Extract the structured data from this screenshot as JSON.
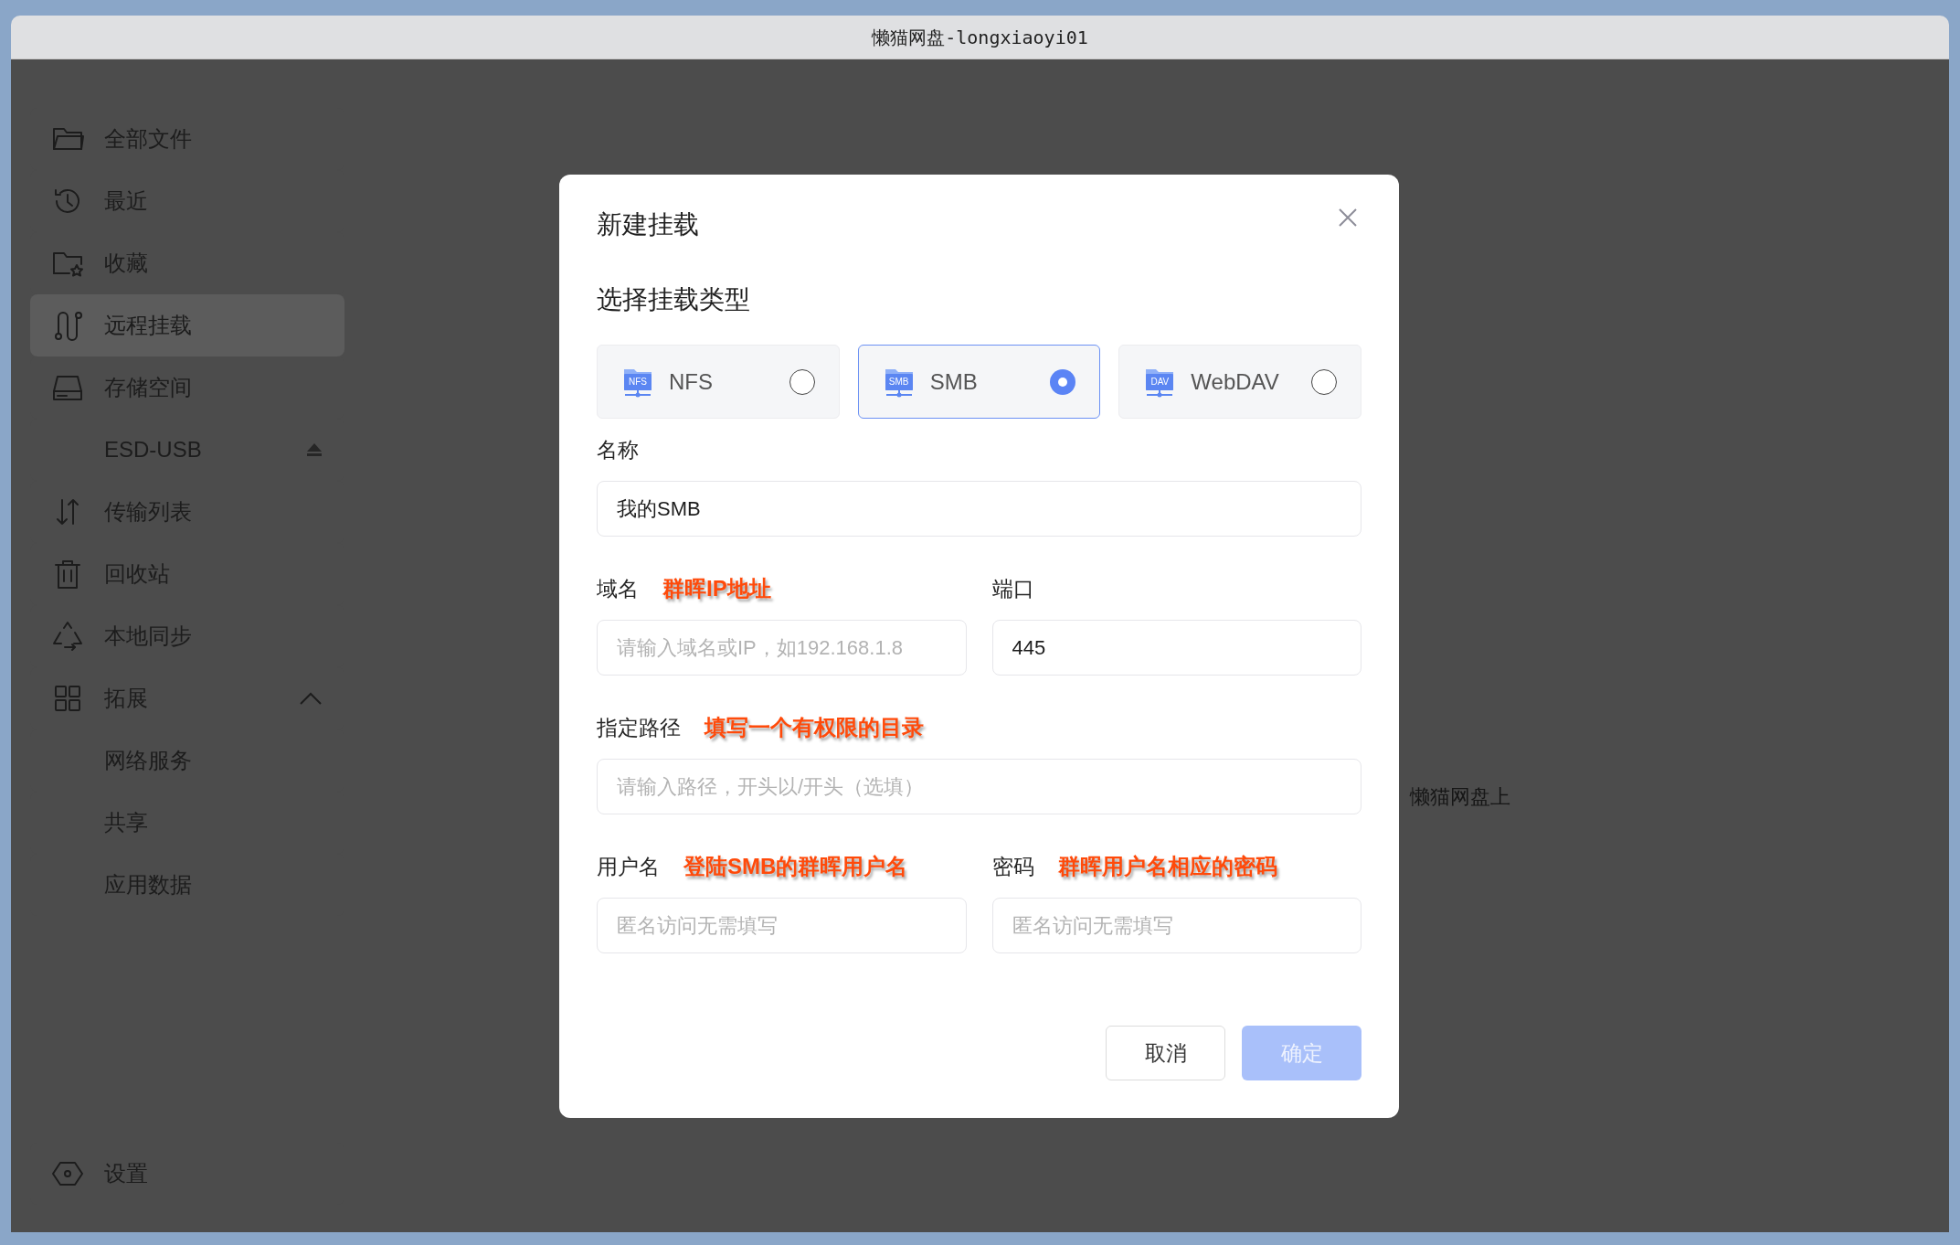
{
  "window": {
    "title": "懒猫网盘-longxiaoyi01"
  },
  "sidebar": {
    "items": [
      {
        "label": "全部文件",
        "selected": false
      },
      {
        "label": "最近",
        "selected": false
      },
      {
        "label": "收藏",
        "selected": false
      },
      {
        "label": "远程挂载",
        "selected": true
      },
      {
        "label": "存储空间",
        "selected": false,
        "children": [
          {
            "label": "ESD-USB",
            "selected": false
          }
        ]
      },
      {
        "label": "传输列表",
        "selected": false
      },
      {
        "label": "回收站",
        "selected": false
      },
      {
        "label": "本地同步",
        "selected": false
      },
      {
        "label": "拓展",
        "selected": false,
        "expanded": true,
        "children": [
          {
            "label": "网络服务",
            "selected": false
          },
          {
            "label": "共享",
            "selected": false
          },
          {
            "label": "应用数据",
            "selected": false
          }
        ]
      }
    ],
    "footer_item": {
      "label": "设置",
      "selected": false
    }
  },
  "background_text": "懒猫网盘上",
  "dialog": {
    "title": "新建挂载",
    "section_title": "选择挂载类型",
    "mount_types": [
      {
        "label": "NFS",
        "badge": "NFS",
        "selected": false
      },
      {
        "label": "SMB",
        "badge": "SMB",
        "selected": true
      },
      {
        "label": "WebDAV",
        "badge": "DAV",
        "selected": false
      }
    ],
    "field_rows": [
      [
        {
          "label": "名称",
          "value": "我的SMB"
        }
      ],
      [
        {
          "label": "域名",
          "annotation": "群晖IP地址",
          "placeholder": "请输入域名或IP，如192.168.1.8"
        },
        {
          "label": "端口",
          "value": "445"
        }
      ],
      [
        {
          "label": "指定路径",
          "annotation": "填写一个有权限的目录",
          "placeholder": "请输入路径，开头以/开头（选填）"
        }
      ],
      [
        {
          "label": "用户名",
          "annotation": "登陆SMB的群晖用户名",
          "placeholder": "匿名访问无需填写"
        },
        {
          "label": "密码",
          "annotation": "群晖用户名相应的密码",
          "placeholder": "匿名访问无需填写"
        }
      ]
    ],
    "buttons": [
      {
        "label": "取消",
        "kind": "secondary",
        "disabled": false
      },
      {
        "label": "确定",
        "kind": "primary",
        "disabled": true
      }
    ]
  }
}
